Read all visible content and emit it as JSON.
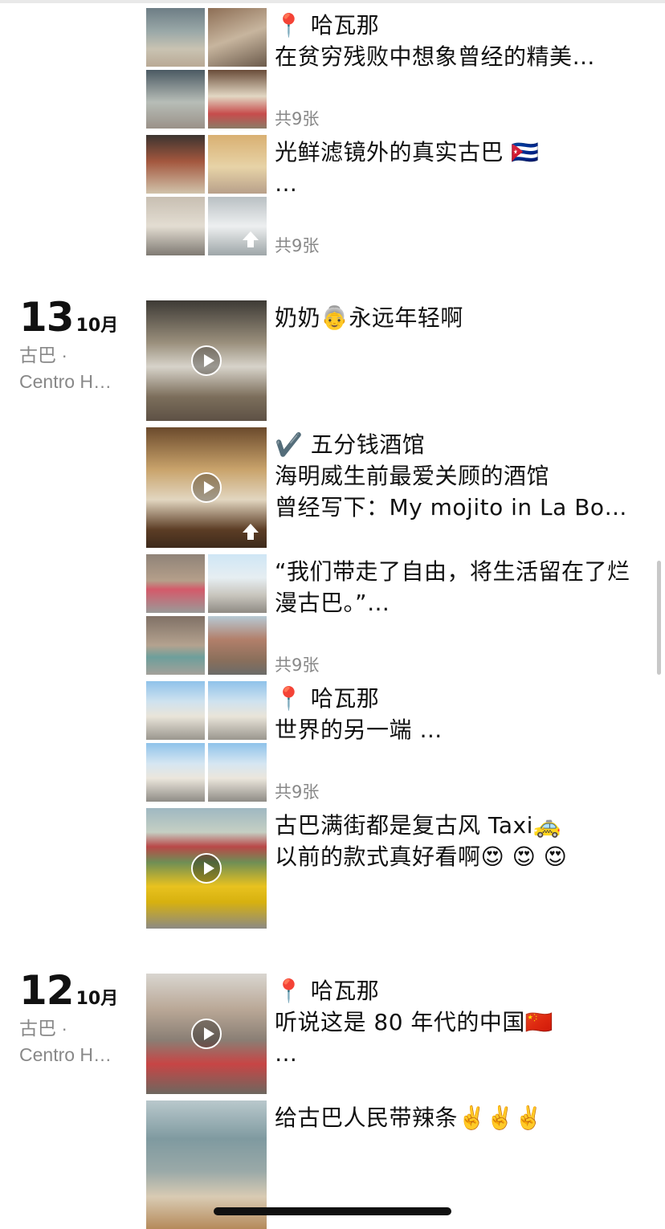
{
  "posts_top": [
    {
      "text": "📍 哈瓦那\n在贫穷残败中想象曾经的精美…",
      "count": "共9张"
    },
    {
      "text": "光鲜滤镜外的真实古巴 🇨🇺\n…",
      "count": "共9张"
    }
  ],
  "day13": {
    "day": "13",
    "month": "10月",
    "location": "古巴 ·\nCentro H…",
    "posts": [
      {
        "text": "奶奶👵永远年轻啊"
      },
      {
        "text": "✔️ 五分钱酒馆\n海明威生前最爱关顾的酒馆\n曾经写下：My mojito in La Bo…"
      },
      {
        "text": "“我们带走了自由，将生活留在了烂漫古巴。”…",
        "count": "共9张"
      },
      {
        "text": "📍 哈瓦那\n世界的另一端 …",
        "count": "共9张"
      },
      {
        "text": "古巴满街都是复古风 Taxi🚕\n以前的款式真好看啊😍 😍 😍"
      }
    ]
  },
  "day12": {
    "day": "12",
    "month": "10月",
    "location": "古巴 ·\nCentro H…",
    "posts": [
      {
        "text": "📍 哈瓦那\n听说这是 80 年代的中国🇨🇳\n…"
      },
      {
        "text": "给古巴人民带辣条✌️✌️✌️"
      }
    ]
  }
}
